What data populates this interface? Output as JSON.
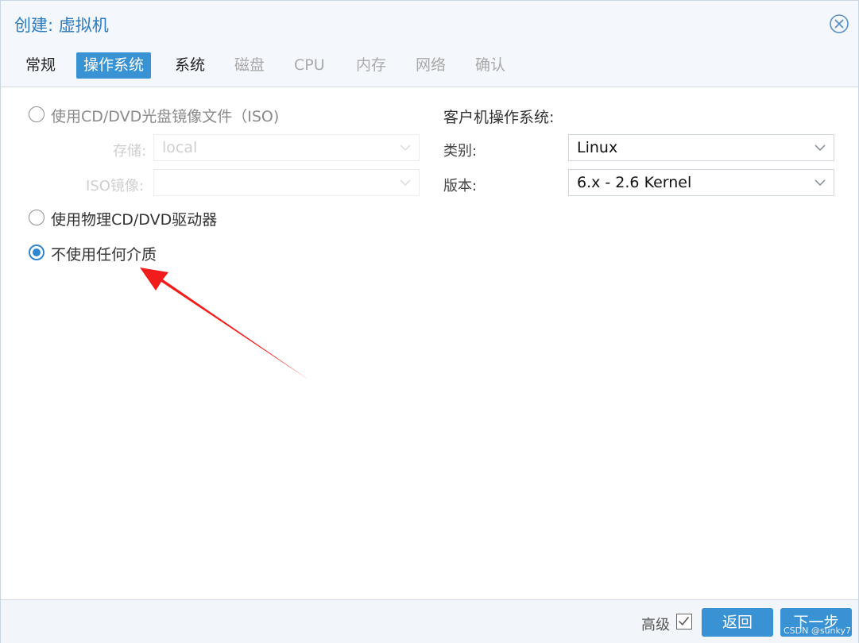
{
  "dialog": {
    "title": "创建: 虚拟机"
  },
  "tabs": [
    {
      "label": "常规",
      "state": "normal"
    },
    {
      "label": "操作系统",
      "state": "active"
    },
    {
      "label": "系统",
      "state": "normal"
    },
    {
      "label": "磁盘",
      "state": "disabled"
    },
    {
      "label": "CPU",
      "state": "disabled"
    },
    {
      "label": "内存",
      "state": "disabled"
    },
    {
      "label": "网络",
      "state": "disabled"
    },
    {
      "label": "确认",
      "state": "disabled"
    }
  ],
  "media": {
    "iso_option_label": "使用CD/DVD光盘镜像文件（ISO)",
    "storage_label": "存储:",
    "storage_value": "local",
    "iso_image_label": "ISO镜像:",
    "iso_image_value": "",
    "physical_option_label": "使用物理CD/DVD驱动器",
    "none_option_label": "不使用任何介质",
    "selected": "none"
  },
  "guest_os": {
    "heading": "客户机操作系统:",
    "type_label": "类别:",
    "type_value": "Linux",
    "version_label": "版本:",
    "version_value": "6.x - 2.6 Kernel"
  },
  "footer": {
    "advanced_label": "高级",
    "advanced_checked": true,
    "back_label": "返回",
    "next_label": "下一步",
    "watermark": "CSDN @sunky7"
  },
  "colors": {
    "accent": "#3892d4",
    "title_text": "#2c7ac0",
    "annotation_arrow": "#f21c1c"
  }
}
